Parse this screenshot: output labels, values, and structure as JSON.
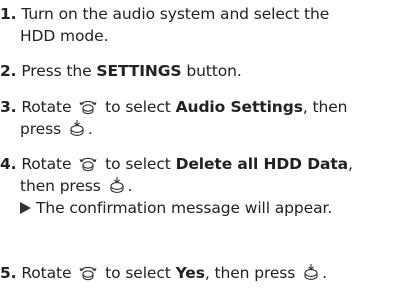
{
  "steps": [
    {
      "number": "1.",
      "text_line1": "Turn on the audio system and select the",
      "text_line2": "HDD mode."
    },
    {
      "number": "2.",
      "before": "Press the ",
      "bold": "SETTINGS",
      "after": " button."
    },
    {
      "number": "3.",
      "rotate": "Rotate",
      "to_select": "to select",
      "bold": "Audio Settings",
      "then_comma": ", then",
      "press": "press",
      "end": "."
    },
    {
      "number": "4.",
      "rotate": "Rotate",
      "to_select": "to select",
      "bold": "Delete all HDD Data",
      "comma": ",",
      "then_press": "then press",
      "end": ".",
      "result": "The confirmation message will appear."
    },
    {
      "number": "5.",
      "rotate": "Rotate",
      "to_select": "to select",
      "bold": "Yes",
      "then_press": ", then press",
      "end": "."
    }
  ],
  "icons": {
    "rotate_knob": "interface-dial-rotate-icon",
    "press_knob": "interface-dial-press-icon",
    "result_arrow": "result-arrow-icon"
  },
  "colors": {
    "text": "#222222",
    "icon": "#333333"
  }
}
